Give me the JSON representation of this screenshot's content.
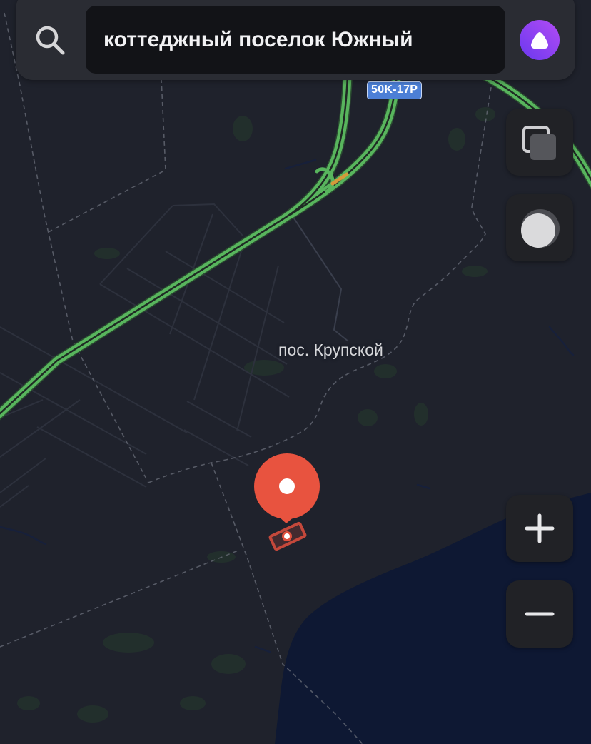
{
  "search": {
    "query": "коттеджный поселок Южный",
    "icon": "search-icon"
  },
  "assistant": {
    "icon": "alice-icon",
    "color": "#8a44f3"
  },
  "map": {
    "road_badges": [
      {
        "label": "50K-17P",
        "color": "#4c7fd6"
      }
    ],
    "place_labels": [
      {
        "label": "пос. Крупской"
      }
    ],
    "selected_place": {
      "icon": "location-pin-icon",
      "color": "#e8533f"
    },
    "colors": {
      "land": "#1f222c",
      "water": "#0e1833",
      "highway": "#58b55d",
      "traffic_slow": "#d49a3a",
      "boundary": "#6a6e7a",
      "vegetation": "#24342c"
    }
  },
  "controls": {
    "layers": {
      "icon": "layers-icon"
    },
    "theme": {
      "icon": "half-moon-icon"
    },
    "zoom_in": {
      "icon": "plus-icon"
    },
    "zoom_out": {
      "icon": "minus-icon"
    }
  }
}
